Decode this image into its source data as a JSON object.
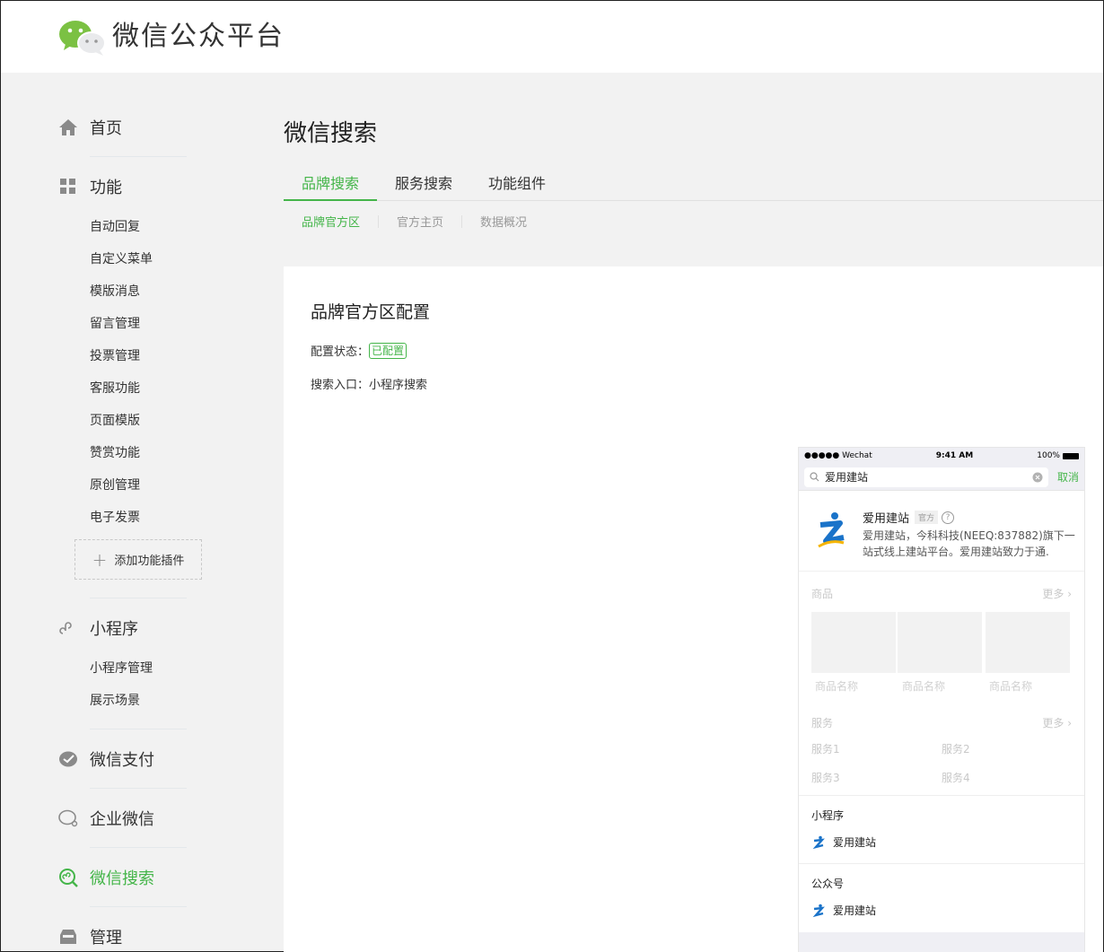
{
  "app": {
    "title": "微信公众平台"
  },
  "sidebar": {
    "home": "首页",
    "functions": {
      "label": "功能",
      "items": [
        "自动回复",
        "自定义菜单",
        "模版消息",
        "留言管理",
        "投票管理",
        "客服功能",
        "页面模版",
        "赞赏功能",
        "原创管理",
        "电子发票"
      ],
      "add_plugin": "添加功能插件"
    },
    "miniprogram": {
      "label": "小程序",
      "items": [
        "小程序管理",
        "展示场景"
      ]
    },
    "pay": "微信支付",
    "work": "企业微信",
    "search": "微信搜索",
    "manage": "管理"
  },
  "main": {
    "title": "微信搜索",
    "tabs": [
      "品牌搜索",
      "服务搜索",
      "功能组件"
    ],
    "subtabs": [
      "品牌官方区",
      "官方主页",
      "数据概况"
    ],
    "panel": {
      "title": "品牌官方区配置",
      "status_label": "配置状态：",
      "status_value": "已配置",
      "entry_label": "搜索入口：",
      "entry_value": "小程序搜索"
    }
  },
  "phone": {
    "carrier": "●●●●● Wechat",
    "time": "9:41 AM",
    "battery": "100%",
    "query": "爱用建站",
    "cancel": "取消",
    "brand": {
      "name": "爱用建站",
      "tag": "官方",
      "desc": "爱用建站，今科科技(NEEQ:837882)旗下一站式线上建站平台。爱用建站致力于通."
    },
    "goods": {
      "title": "商品",
      "more": "更多",
      "names": [
        "商品名称",
        "商品名称",
        "商品名称"
      ]
    },
    "services": {
      "title": "服务",
      "more": "更多",
      "items": [
        "服务1",
        "服务2",
        "服务3",
        "服务4"
      ]
    },
    "mini_section": {
      "title": "小程序",
      "item": "爱用建站"
    },
    "mp_section": {
      "title": "公众号",
      "item": "爱用建站"
    }
  },
  "colors": {
    "accent": "#44b549",
    "background": "#f2f2f2",
    "brand_blue": "#1a73c9"
  }
}
